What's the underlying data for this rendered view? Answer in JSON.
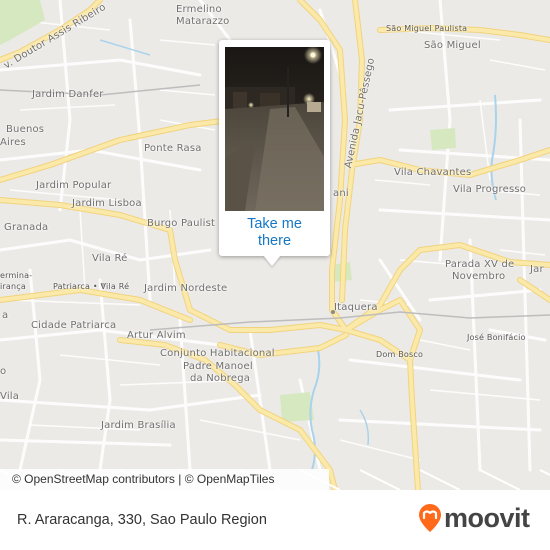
{
  "map": {
    "labels": {
      "ermelino": "Ermelino",
      "matarazzo": "Matarazzo",
      "sao_miguel_paulista": "São Miguel Paulista",
      "sao_miguel": "São Miguel",
      "av_doutor_assis": "v. Doutor Assis Ribeiro",
      "jardim_danfer": "Jardim Danfer",
      "buenos": "Buenos",
      "aires": "Aires",
      "ponte_rasa": "Ponte Rasa",
      "avenida_jacu": "Avenida Jacu-Pêssego",
      "jardim_popular": "Jardim Popular",
      "jardim_lisboa": "Jardim Lisboa",
      "granada": "Granada",
      "burgo_paulista": "Burgo Paulist",
      "vila_chavantes": "Vila Chavantes",
      "vila_progresso": "Vila Progresso",
      "ani": "ani",
      "vila_re": "Vila Ré",
      "ermelina": "ermina-",
      "iranca": "irança",
      "patriarca_vila_re": "Patriarca • Vila Ré",
      "jardim_nordeste": "Jardim Nordeste",
      "parada_xv": "Parada XV de",
      "novembro": "Novembro",
      "jar": "Jar",
      "itaquera": "Itaquera",
      "cidade_patriarca": "Cidade Patriarca",
      "artur_alvim": "Artur Alvim",
      "jose_bonifacio": "José Bonifácio",
      "conjunto": "Conjunto Habitacional",
      "padre_manoel": "Padre Manoel",
      "da_nobrega": "da Nobrega",
      "dom_bosco": "Dom Bosco",
      "vila": "Vila",
      "jardim_brasilia": "Jardim Brasília",
      "a": "a",
      "o": "o"
    }
  },
  "popup": {
    "cta_line1": "Take me",
    "cta_line2": "there"
  },
  "attribution": {
    "text": "© OpenStreetMap contributors | © OpenMapTiles"
  },
  "footer": {
    "address": "R. Araracanga, 330, Sao Paulo Region",
    "brand": "moovit"
  },
  "colors": {
    "map_bg": "#eceae6",
    "major_road": "#fbe9a9",
    "major_road_edge": "#f1d37e",
    "minor_road": "#ffffff",
    "park": "#d6e8c0",
    "water": "#a9d3ec",
    "link": "#1677c5",
    "brand_orange": "#ff6a1a",
    "brand_text": "#444444"
  },
  "icons": {
    "brand_logo": "moovit-pin-icon"
  }
}
